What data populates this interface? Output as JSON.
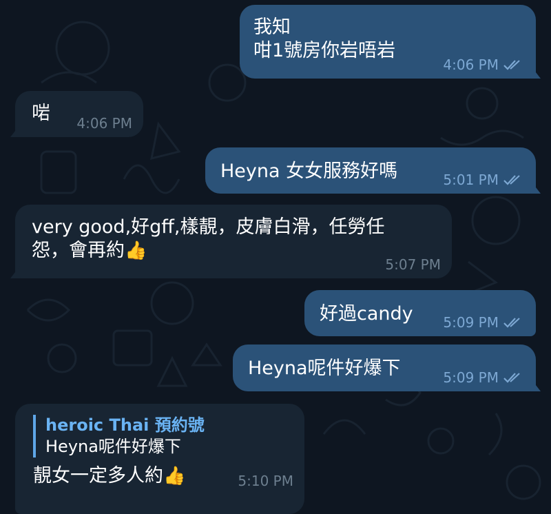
{
  "messages": [
    {
      "id": "m1",
      "dir": "out",
      "lines": [
        "我知",
        "咁1號房你岩唔岩"
      ],
      "time": "4:06 PM",
      "read": true
    },
    {
      "id": "m2",
      "dir": "in",
      "text": "啱",
      "time": "4:06 PM"
    },
    {
      "id": "m3",
      "dir": "out",
      "text": "Heyna 女女服務好嗎",
      "time": "5:01 PM",
      "read": true
    },
    {
      "id": "m4",
      "dir": "in",
      "lines": [
        "very good,好gff,樣靚，皮膚白滑，任勞任",
        "怨，會再約"
      ],
      "emoji": "👍",
      "time": "5:07 PM"
    },
    {
      "id": "m5",
      "dir": "out",
      "text": "好過candy",
      "time": "5:09 PM",
      "read": true
    },
    {
      "id": "m6",
      "dir": "out",
      "text": "Heyna呢件好爆下",
      "time": "5:09 PM",
      "read": true
    },
    {
      "id": "m7",
      "dir": "in",
      "reply": {
        "name": "heroic Thai 預約號",
        "text": "Heyna呢件好爆下"
      },
      "text": "靚女一定多人約",
      "emoji": "👍",
      "time": "5:10 PM"
    }
  ],
  "colors": {
    "background": "#0e1621",
    "outgoing_bubble": "#2b5278",
    "incoming_bubble": "#182533",
    "reply_accent": "#6ab3f3"
  },
  "icons": {
    "read_receipt": "double-check-icon",
    "emoji": "thumbs-up-icon"
  }
}
